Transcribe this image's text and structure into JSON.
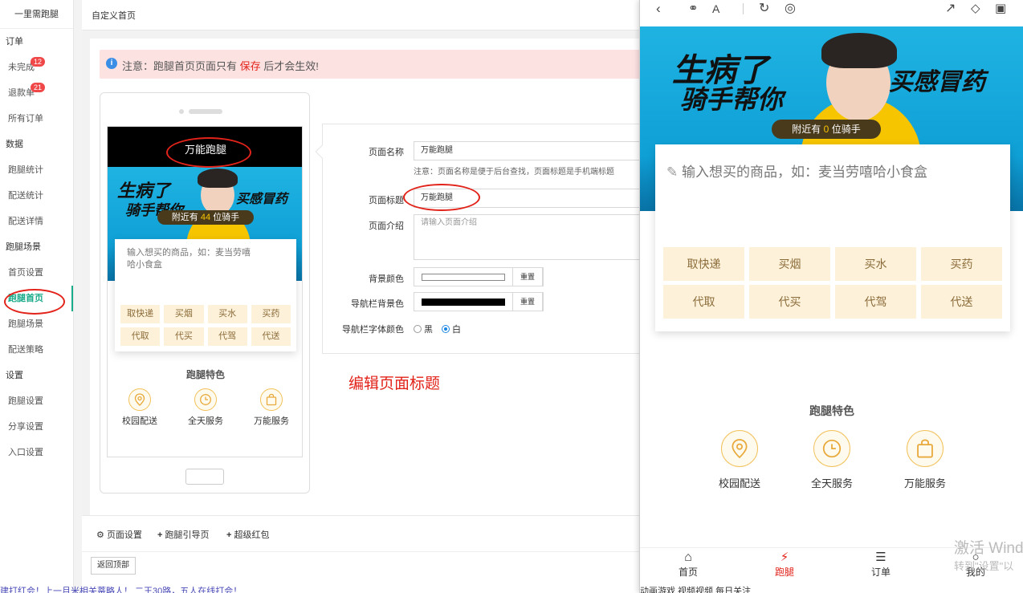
{
  "sidebar": {
    "brand": "一里需跑腿",
    "groups": {
      "order": "订单",
      "data": "数据",
      "scene": "跑腿场景",
      "settings": "设置"
    },
    "items": {
      "unfinished": "未完成",
      "refund": "退款单",
      "all_orders": "所有订单",
      "errand_stats": "跑腿统计",
      "delivery_stats": "配送统计",
      "delivery_detail": "配送详情",
      "home_settings": "首页设置",
      "errand_home": "跑腿首页",
      "errand_scene": "跑腿场景",
      "delivery_policy": "配送策略",
      "errand_settings": "跑腿设置",
      "share_settings": "分享设置",
      "entry_settings": "入口设置"
    },
    "badges": {
      "unfinished": "12",
      "refund": "21"
    }
  },
  "topbar": {
    "title": "自定义首页"
  },
  "notice": {
    "prefix": "注意：跑腿首页页面只有",
    "highlight": "保存",
    "suffix": "后才会生效!"
  },
  "preview": {
    "page_title": "万能跑腿",
    "banner": {
      "slogan_left": "生病了",
      "slogan_left2": "骑手帮你",
      "slogan_right": "买感冒药"
    },
    "riders": {
      "prefix": "附近有",
      "count": "44",
      "suffix": "位骑手"
    },
    "search_placeholder": "输入想买的商品，如：麦当劳嘻哈小食盒",
    "services": [
      "取快递",
      "买烟",
      "买水",
      "买药",
      "代取",
      "代买",
      "代驾",
      "代送"
    ],
    "features_title": "跑腿特色",
    "features": [
      "校园配送",
      "全天服务",
      "万能服务"
    ]
  },
  "form": {
    "page_name_label": "页面名称",
    "page_name_value": "万能跑腿",
    "page_name_hint": "注意：页面名称是便于后台查找，页面标题是手机端标题",
    "page_title_label": "页面标题",
    "page_title_value": "万能跑腿",
    "page_intro_label": "页面介绍",
    "page_intro_placeholder": "请输入页面介绍",
    "bg_color_label": "背景颜色",
    "nav_bg_label": "导航栏背景色",
    "reset_label": "重置",
    "nav_font_label": "导航栏字体颜色",
    "opt_black": "黑",
    "opt_white": "白",
    "colors": {
      "bg": "#ffffff",
      "nav_bg": "#000000"
    }
  },
  "annotation": "编辑页面标题",
  "bottom": {
    "page_settings": "页面设置",
    "errand_guide": "跑腿引导页",
    "red_packet": "超级红包",
    "back_top": "返回顶部"
  },
  "taskbar_left": "建打红会！上一月米相关蒂略人！ 二王30路，五人在线打会！",
  "mobile": {
    "riders": {
      "prefix": "附近有",
      "count": "0",
      "suffix": "位骑手"
    },
    "tabs": [
      "首页",
      "跑腿",
      "订单",
      "我的"
    ],
    "watermark": "激活 Wind",
    "watermark2": "转到\"设置\"以",
    "taskbar": "动画游戏  视频视频  每日关注"
  },
  "colors": {
    "accent": "#1aab8a",
    "annotation": "#e2231a",
    "service_bg": "#fdf2d9",
    "service_text": "#8b6b3a"
  }
}
